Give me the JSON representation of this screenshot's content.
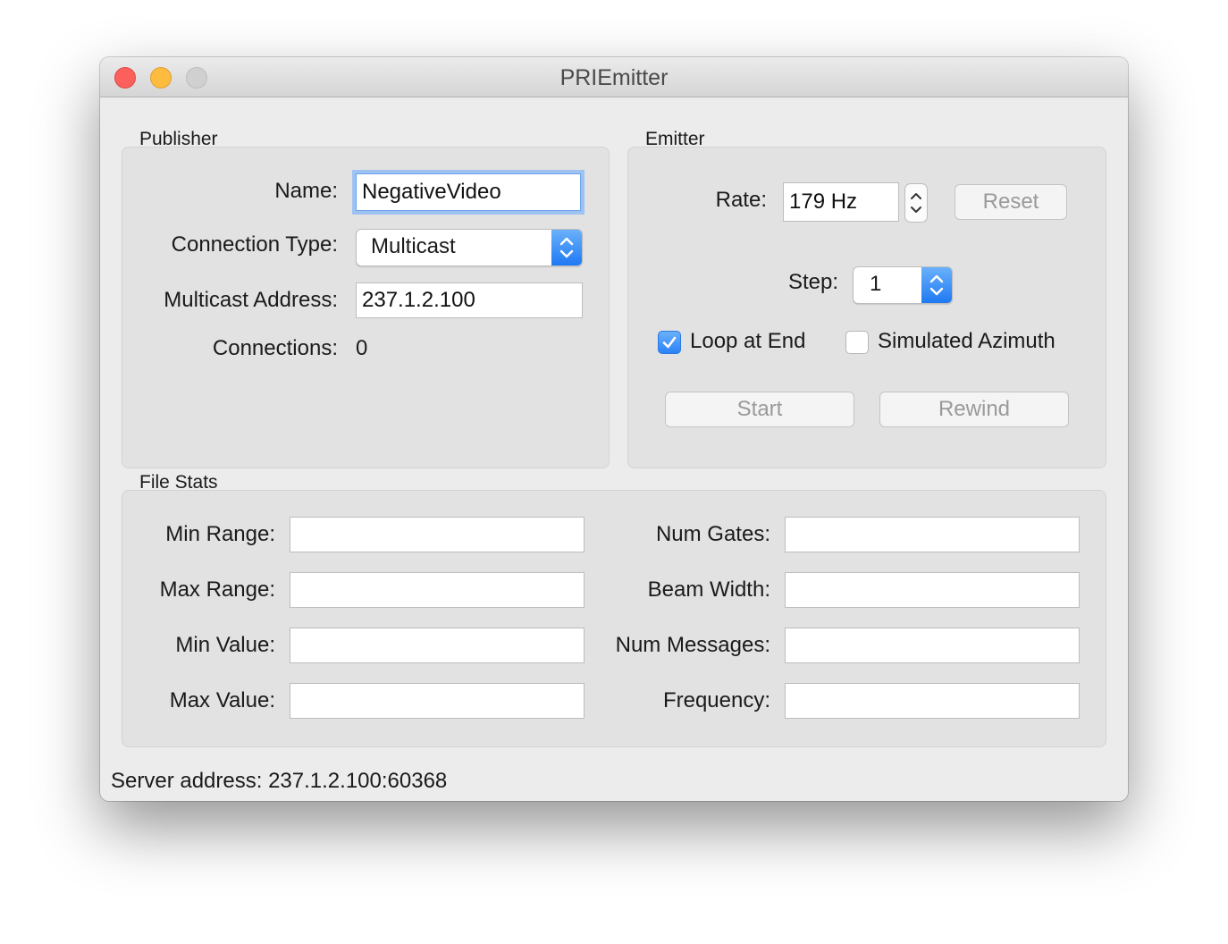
{
  "window": {
    "title": "PRIEmitter"
  },
  "publisher": {
    "title": "Publisher",
    "name_label": "Name:",
    "name_value": "NegativeVideo",
    "connection_type_label": "Connection Type:",
    "connection_type_value": "Multicast",
    "multicast_address_label": "Multicast Address:",
    "multicast_address_value": "237.1.2.100",
    "connections_label": "Connections:",
    "connections_value": "0"
  },
  "emitter": {
    "title": "Emitter",
    "rate_label": "Rate:",
    "rate_value": "179 Hz",
    "reset_label": "Reset",
    "step_label": "Step:",
    "step_value": "1",
    "loop_label": "Loop at End",
    "loop_checked": true,
    "simulated_label": "Simulated Azimuth",
    "simulated_checked": false,
    "start_label": "Start",
    "rewind_label": "Rewind"
  },
  "file_stats": {
    "title": "File Stats",
    "min_range_label": "Min Range:",
    "max_range_label": "Max Range:",
    "min_value_label": "Min Value:",
    "max_value_label": "Max Value:",
    "num_gates_label": "Num Gates:",
    "beam_width_label": "Beam Width:",
    "num_messages_label": "Num Messages:",
    "frequency_label": "Frequency:"
  },
  "status": {
    "server_address": "Server address: 237.1.2.100:60368"
  },
  "colors": {
    "accent": "#2b82f6",
    "close": "#fc605c",
    "minimize": "#fdbc40",
    "zoom_disabled": "#d0d0d0"
  }
}
